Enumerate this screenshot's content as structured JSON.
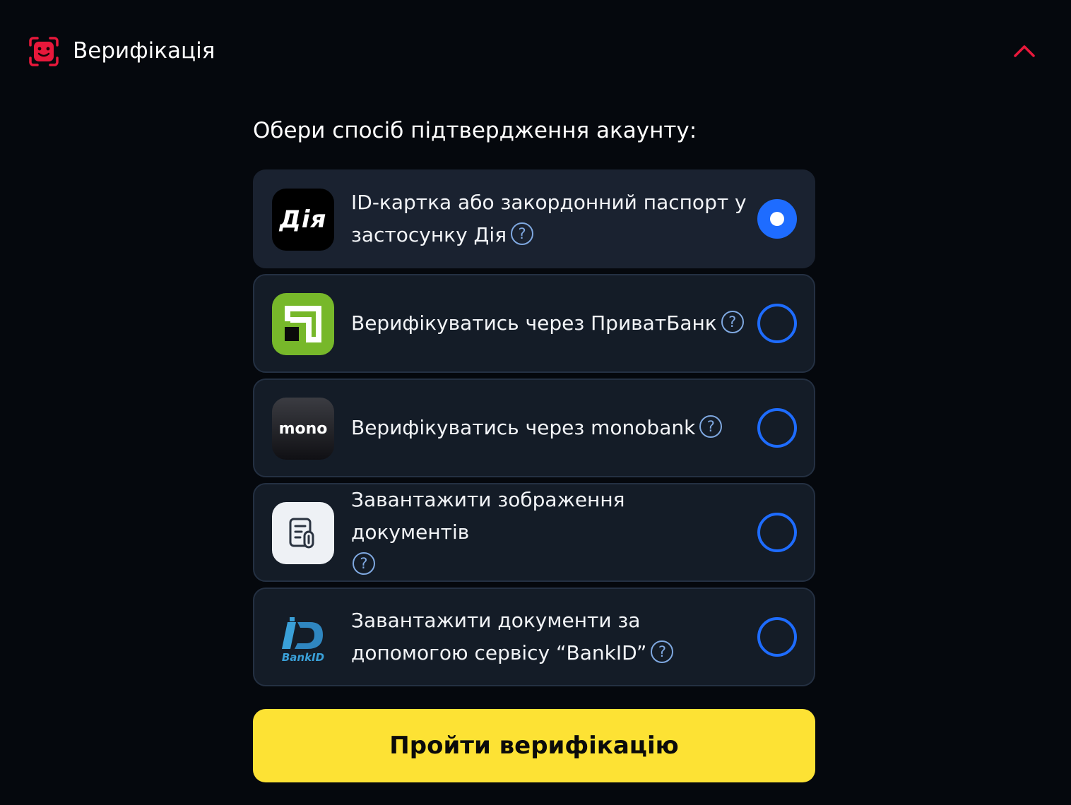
{
  "header": {
    "title": "Верифікація",
    "icon": "face-scan-icon",
    "collapse_icon": "chevron-up-icon",
    "accent_color": "#e8183b"
  },
  "prompt": "Обери спосіб підтвердження акаунту:",
  "options": [
    {
      "logo": "diia-logo",
      "logo_text": "Дія",
      "label": "ID-картка або закордонний паспорт у застосунку Дія",
      "help": "?",
      "selected": true
    },
    {
      "logo": "privatbank-logo",
      "logo_text": "",
      "label": "Верифікуватись через ПриватБанк",
      "help": "?",
      "selected": false
    },
    {
      "logo": "monobank-logo",
      "logo_text": "mono",
      "label": "Верифікуватись через monobank",
      "help": "?",
      "selected": false
    },
    {
      "logo": "document-upload-icon",
      "logo_text": "",
      "label": "Завантажити зображення документів",
      "help": "?",
      "selected": false
    },
    {
      "logo": "bankid-logo",
      "logo_text": "BankID",
      "label": "Завантажити документи за допомогою сервісу “BankID”",
      "help": "?",
      "selected": false
    }
  ],
  "submit_label": "Пройти верифікацію",
  "colors": {
    "background": "#05080d",
    "card": "#141c27",
    "radio": "#1e6cff",
    "button": "#fde234"
  }
}
